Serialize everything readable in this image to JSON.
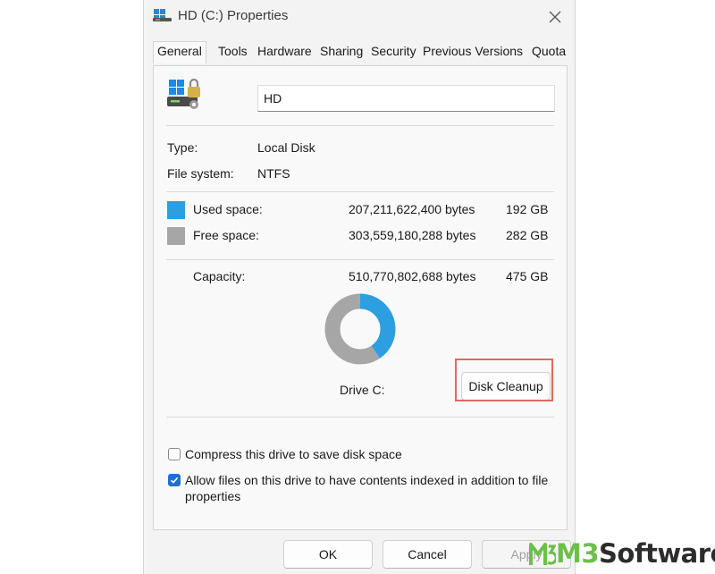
{
  "window": {
    "title": "HD (C:) Properties"
  },
  "tabs": [
    {
      "label": "General",
      "active": true
    },
    {
      "label": "Tools"
    },
    {
      "label": "Hardware"
    },
    {
      "label": "Sharing"
    },
    {
      "label": "Security"
    },
    {
      "label": "Previous Versions"
    },
    {
      "label": "Quota"
    }
  ],
  "drive_name": "HD",
  "info": {
    "type_label": "Type:",
    "type_value": "Local Disk",
    "fs_label": "File system:",
    "fs_value": "NTFS"
  },
  "space": {
    "used_label": "Used space:",
    "used_bytes": "207,211,622,400 bytes",
    "used_gb": "192 GB",
    "free_label": "Free space:",
    "free_bytes": "303,559,180,288 bytes",
    "free_gb": "282 GB",
    "capacity_label": "Capacity:",
    "capacity_bytes": "510,770,802,688 bytes",
    "capacity_gb": "475 GB"
  },
  "chart_data": {
    "type": "pie",
    "categories": [
      "Used space",
      "Free space"
    ],
    "values": [
      207211622400,
      303559180288
    ],
    "colors": [
      "#2d9fe0",
      "#a6a6a6"
    ]
  },
  "drive_label": "Drive C:",
  "disk_cleanup_label": "Disk Cleanup",
  "options": {
    "compress_label": "Compress this drive to save disk space",
    "compress_checked": false,
    "index_label_1": "Allow files on this drive to have contents indexed in addition to file",
    "index_label_2": "properties",
    "index_checked": true
  },
  "buttons": {
    "ok": "OK",
    "cancel": "Cancel",
    "apply": "Apply"
  },
  "watermark": {
    "m3": "M3",
    "software": "Software"
  },
  "colors": {
    "used": "#2d9fe0",
    "free": "#a6a6a6",
    "highlight": "#e06a5f",
    "accent": "#1e6fcf",
    "watermark_green": "#6cc04a"
  }
}
